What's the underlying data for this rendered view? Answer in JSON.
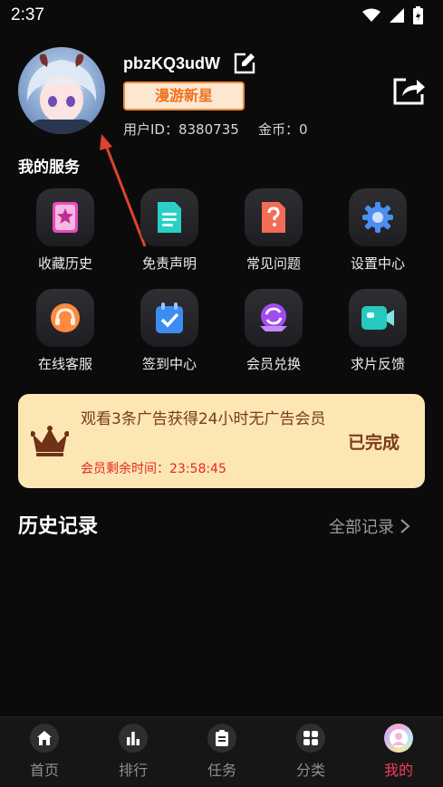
{
  "status": {
    "time": "2:37"
  },
  "profile": {
    "username": "pbzKQ3udW",
    "badge": "漫游新星",
    "user_id": "用户ID：8380735",
    "coins": "金币：0"
  },
  "services": {
    "title": "我的服务",
    "items": [
      {
        "label": "收藏历史",
        "icon": "bookmark-star-icon",
        "color": "#e84bb6"
      },
      {
        "label": "免责声明",
        "icon": "document-icon",
        "color": "#2ad0c6"
      },
      {
        "label": "常见问题",
        "icon": "question-doc-icon",
        "color": "#f26d55"
      },
      {
        "label": "设置中心",
        "icon": "gear-icon",
        "color": "#4b8ff0"
      },
      {
        "label": "在线客服",
        "icon": "headset-icon",
        "color": "#ff8a3d"
      },
      {
        "label": "签到中心",
        "icon": "checkin-icon",
        "color": "#3d8cf2"
      },
      {
        "label": "会员兑换",
        "icon": "exchange-icon",
        "color": "#a34bf2"
      },
      {
        "label": "求片反馈",
        "icon": "video-camera-icon",
        "color": "#25c9c0"
      }
    ]
  },
  "vip": {
    "text": "观看3条广告获得24小时无广告会员",
    "timer": "会员剩余时间：23:58:45",
    "status": "已完成",
    "bg_color": "#fbe6b4",
    "text_color": "#7a3b1a",
    "timer_color": "#e8261c"
  },
  "history": {
    "title": "历史记录",
    "all_label": "全部记录"
  },
  "tabbar": {
    "tabs": [
      {
        "label": "首页",
        "icon": "home-icon"
      },
      {
        "label": "排行",
        "icon": "chart-icon"
      },
      {
        "label": "任务",
        "icon": "clipboard-icon"
      },
      {
        "label": "分类",
        "icon": "grid-icon"
      },
      {
        "label": "我的",
        "icon": "profile-avatar-icon",
        "active": true
      }
    ],
    "active_color": "#f23b5f"
  },
  "annotation": {
    "arrow_color": "#e0432e"
  }
}
